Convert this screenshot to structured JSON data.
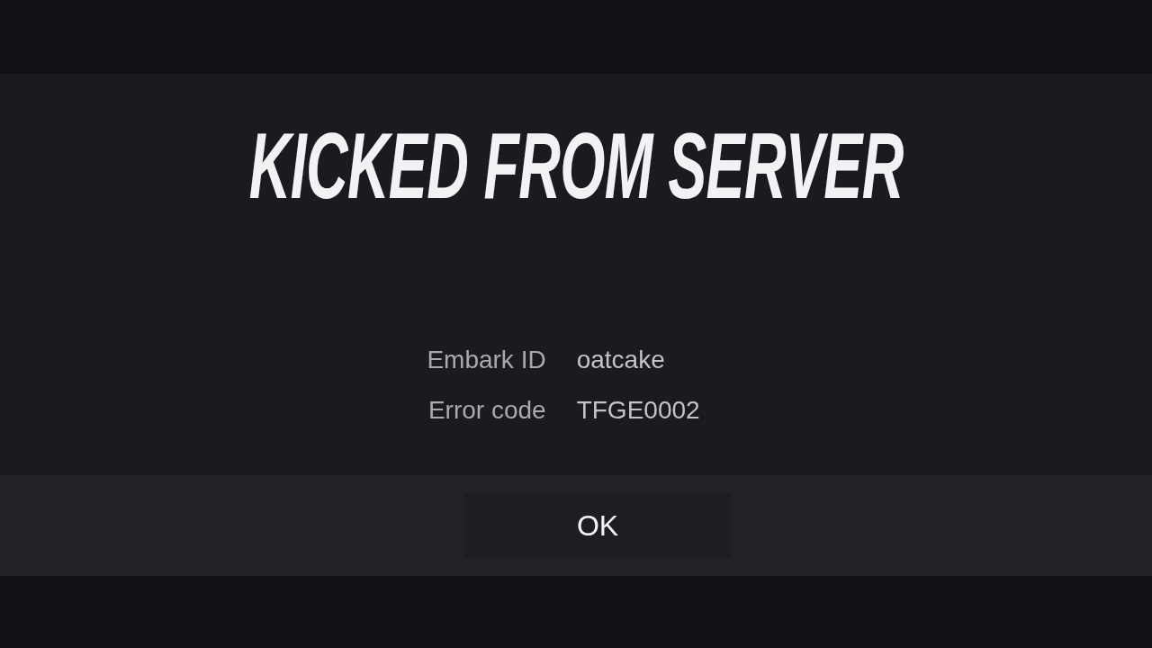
{
  "dialog": {
    "title": "KICKED FROM SERVER",
    "fields": [
      {
        "label": "Embark ID",
        "value": "oatcake"
      },
      {
        "label": "Error code",
        "value": "TFGE0002"
      }
    ]
  },
  "buttons": [
    "OK"
  ]
}
